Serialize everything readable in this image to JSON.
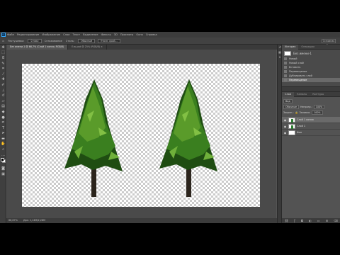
{
  "app": {
    "logo": "Ps"
  },
  "menu": [
    "Файл",
    "Редактирование",
    "Изображение",
    "Слои",
    "Текст",
    "Выделение",
    "Фильтр",
    "3D",
    "Просмотр",
    "Окно",
    "Справка"
  ],
  "options": {
    "items": [
      "Растушевка:",
      "0 пикс",
      "Сглаживание",
      "Стиль:",
      "Обычный",
      "Уточн. край..."
    ],
    "workspace": "Основная рабочая среда"
  },
  "tabs": [
    {
      "label": "Без имени-1 @ 66,7% (Слой 1 копия, RGB/8)",
      "active": true
    },
    {
      "label": "Ель.psd @ 25% (RGB/8) ×",
      "active": false
    }
  ],
  "status": {
    "zoom": "66,67%",
    "doc": "Док: 1,14M/2,28M"
  },
  "history": {
    "tab": "История",
    "tab2": "Операции",
    "snapshot": "Без имени-1",
    "items": [
      {
        "label": "Новый",
        "selected": false
      },
      {
        "label": "Новый слой",
        "selected": false
      },
      {
        "label": "Вставить",
        "selected": false
      },
      {
        "label": "Перемещение",
        "selected": false
      },
      {
        "label": "Дублировать слой",
        "selected": false
      },
      {
        "label": "Перемещение",
        "selected": true
      }
    ]
  },
  "layers": {
    "tabs": [
      "Слои",
      "Каналы",
      "Контуры"
    ],
    "filter": "Вид",
    "blend": "Обычные",
    "opacity_label": "Непрозр.:",
    "opacity": "100%",
    "lock_label": "Закреп.:",
    "fill_label": "Заливка:",
    "fill": "100%",
    "items": [
      {
        "name": "Слой 1 копия",
        "thumb": "tree-t",
        "selected": true
      },
      {
        "name": "Слой 1",
        "thumb": "tree-t",
        "selected": false
      },
      {
        "name": "Фон",
        "thumb": "white",
        "selected": false
      }
    ],
    "footer_icons": [
      "link-icon",
      "fx-icon",
      "mask-icon",
      "adjustment-icon",
      "folder-icon",
      "new-layer-icon",
      "trash-icon"
    ]
  },
  "colors": {
    "foreground": "#000000",
    "background": "#ffffff",
    "tree_dark": "#1f4d12",
    "tree_mid": "#3a7f1f",
    "tree_light": "#6fb03a",
    "trunk": "#2b241c"
  },
  "canvas": {
    "trees": 2
  }
}
